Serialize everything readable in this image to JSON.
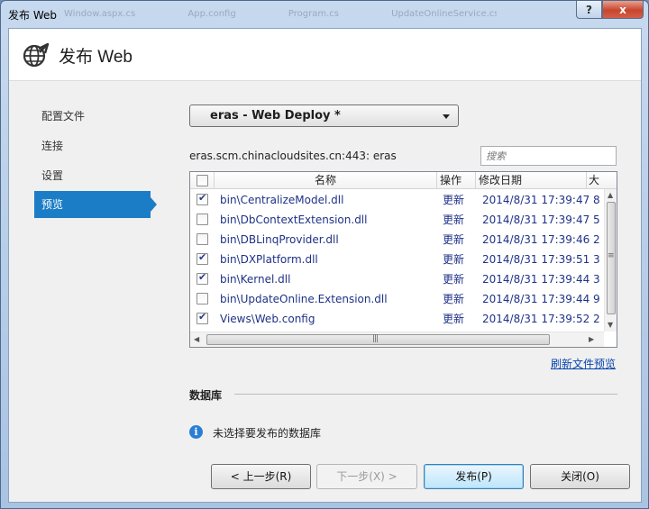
{
  "window": {
    "title": "发布 Web",
    "ghost_tabs": [
      "Window.aspx.cs",
      "App.config",
      "Program.cs",
      "UpdateOnlineService.cs"
    ],
    "help_label": "?",
    "close_label": "x"
  },
  "header": {
    "title": "发布 Web",
    "icon": "globe-arrow-icon"
  },
  "nav": {
    "items": [
      {
        "label": "配置文件",
        "active": false
      },
      {
        "label": "连接",
        "active": false
      },
      {
        "label": "设置",
        "active": false
      },
      {
        "label": "预览",
        "active": true
      }
    ]
  },
  "profile": {
    "selected": "eras - Web Deploy *"
  },
  "site": {
    "label": "eras.scm.chinacloudsites.cn:443: eras",
    "search_placeholder": "搜索"
  },
  "table": {
    "columns": [
      "",
      "名称",
      "操作",
      "修改日期",
      "大"
    ],
    "rows": [
      {
        "checked": true,
        "name": "bin\\CentralizeModel.dll",
        "op": "更新",
        "date": "2014/8/31 17:39:47",
        "size": "8"
      },
      {
        "checked": false,
        "name": "bin\\DbContextExtension.dll",
        "op": "更新",
        "date": "2014/8/31 17:39:47",
        "size": "5"
      },
      {
        "checked": false,
        "name": "bin\\DBLinqProvider.dll",
        "op": "更新",
        "date": "2014/8/31 17:39:46",
        "size": "2"
      },
      {
        "checked": true,
        "name": "bin\\DXPlatform.dll",
        "op": "更新",
        "date": "2014/8/31 17:39:51",
        "size": "3"
      },
      {
        "checked": true,
        "name": "bin\\Kernel.dll",
        "op": "更新",
        "date": "2014/8/31 17:39:44",
        "size": "3"
      },
      {
        "checked": false,
        "name": "bin\\UpdateOnline.Extension.dll",
        "op": "更新",
        "date": "2014/8/31 17:39:44",
        "size": "9"
      },
      {
        "checked": true,
        "name": "Views\\Web.config",
        "op": "更新",
        "date": "2014/8/31 17:39:52",
        "size": "2"
      }
    ]
  },
  "refresh_link": "刷新文件预览",
  "database": {
    "title": "数据库",
    "message": "未选择要发布的数据库"
  },
  "buttons": {
    "prev": "< 上一步(R)",
    "next": "下一步(X) >",
    "publish": "发布(P)",
    "close": "关闭(O)"
  },
  "colors": {
    "accent": "#1c7dc7",
    "link": "#0645ad",
    "row_text": "#1e3287"
  }
}
